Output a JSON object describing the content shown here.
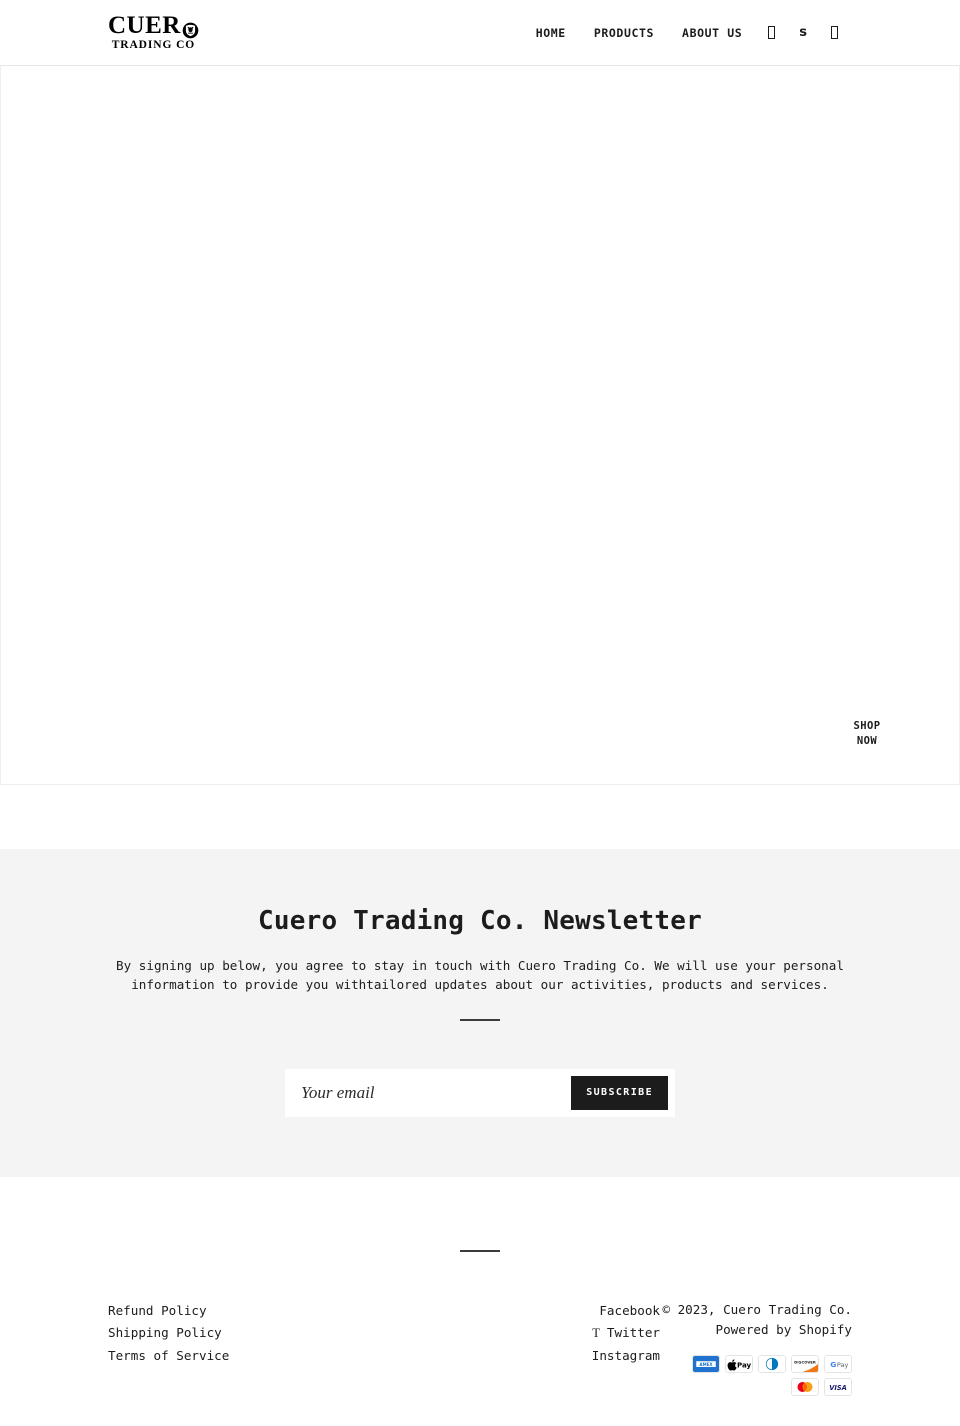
{
  "header": {
    "logo": {
      "line1": "CUER",
      "mark": "crest-emblem",
      "line2": "TRADING CO",
      "alt": "Cuero Trading Co."
    },
    "nav": [
      {
        "label": "HOME"
      },
      {
        "label": "PRODUCTS"
      },
      {
        "label": "ABOUT US"
      }
    ],
    "icons": [
      {
        "name": "account-icon",
        "glyph": ""
      },
      {
        "name": "search-icon",
        "glyph": "s"
      },
      {
        "name": "cart-icon",
        "glyph": ""
      }
    ]
  },
  "hero": {
    "cta_label": "SHOP NOW"
  },
  "newsletter": {
    "title": "Cuero Trading Co. Newsletter",
    "body": "By signing up below, you agree to stay in touch with Cuero Trading Co. We will use your personal information to provide you withtailored updates about our activities, products and services.",
    "email_placeholder": "Your email",
    "email_value": "",
    "subscribe_label": "SUBSCRIBE"
  },
  "footer": {
    "policies": [
      {
        "label": "Refund Policy"
      },
      {
        "label": "Shipping Policy"
      },
      {
        "label": "Terms of Service"
      }
    ],
    "social": [
      {
        "label": "Facebook",
        "glyph": ""
      },
      {
        "label": "Twitter",
        "glyph": "T"
      },
      {
        "label": "Instagram",
        "glyph": ""
      }
    ],
    "copyright": "© 2023, Cuero Trading Co.",
    "powered_by_prefix": "Powered by ",
    "powered_by_link": "Shopify",
    "payments": [
      {
        "name": "amex",
        "label": "AMEX"
      },
      {
        "name": "apple-pay",
        "label": "Apple Pay"
      },
      {
        "name": "diners-club",
        "label": "Diners Club"
      },
      {
        "name": "discover",
        "label": "DISCOVER"
      },
      {
        "name": "google-pay",
        "label": "G Pay"
      },
      {
        "name": "mastercard",
        "label": "Mastercard"
      },
      {
        "name": "visa",
        "label": "VISA"
      }
    ]
  },
  "colors": {
    "ink": "#1c1c1c",
    "band": "#f4f4f4",
    "border": "#e8e8e8",
    "amex_blue": "#1f72cd",
    "discover_orange": "#f27712",
    "mastercard_red": "#eb001b",
    "mastercard_orange": "#f79e1b",
    "visa_blue": "#1a1f71",
    "gpay_blue": "#4285f4"
  }
}
